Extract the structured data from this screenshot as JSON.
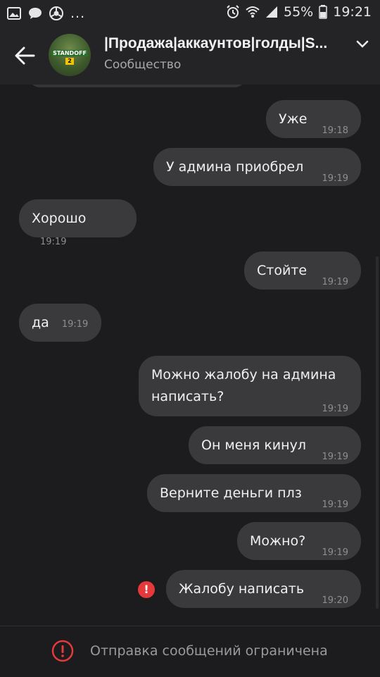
{
  "status_bar": {
    "battery": "55%",
    "time": "19:21",
    "more": "..."
  },
  "header": {
    "title": "|Продажа|аккаунтов|голды|S...",
    "subtitle": "Сообщество",
    "avatar_text": "STANDOFF",
    "avatar_num": "2"
  },
  "messages": [
    {
      "text": "Уже",
      "time": "19:18",
      "direction": "out"
    },
    {
      "text": "У админа приобрел",
      "time": "19:19",
      "direction": "out"
    },
    {
      "text": "Хорошо",
      "time": "19:19",
      "direction": "in"
    },
    {
      "text": "Стойте",
      "time": "19:19",
      "direction": "out"
    },
    {
      "text": "да",
      "time": "19:19",
      "direction": "in"
    },
    {
      "text_line1": "Можно жалобу на админа",
      "text_line2": "написать?",
      "time": "19:19",
      "direction": "out"
    },
    {
      "text": "Он меня кинул",
      "time": "19:19",
      "direction": "out"
    },
    {
      "text": "Верните деньги плз",
      "time": "19:19",
      "direction": "out"
    },
    {
      "text": "Можно?",
      "time": "19:19",
      "direction": "out"
    },
    {
      "text": "Жалобу написать",
      "time": "19:20",
      "direction": "out",
      "failed": true
    }
  ],
  "bottom": {
    "label": "Отправка сообщений ограничена"
  },
  "colors": {
    "background": "#1c1c1e",
    "bubble": "#3a3a3c",
    "error": "#e5393b"
  }
}
